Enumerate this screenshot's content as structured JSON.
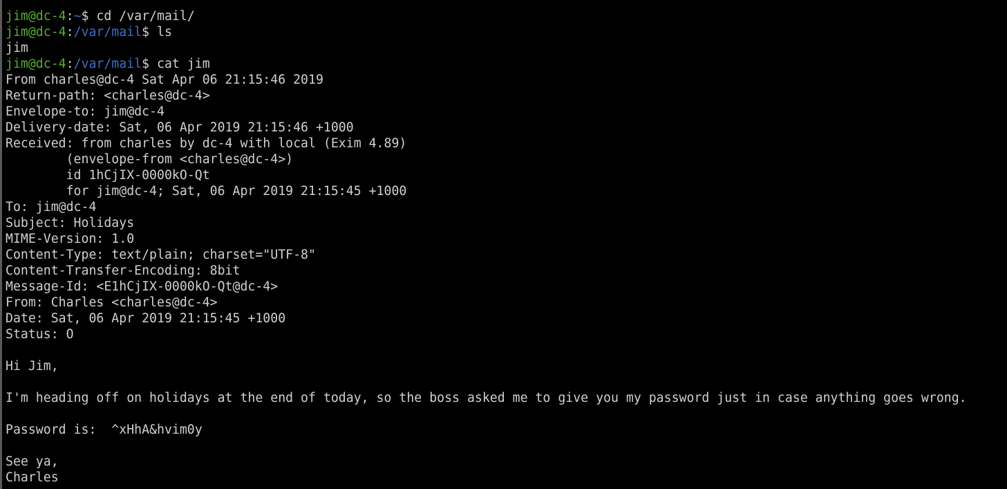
{
  "colors": {
    "background": "#000000",
    "foreground": "#d0d0d0",
    "user_host": "#4fb226",
    "path": "#3b6fc6"
  },
  "session": [
    {
      "type": "prompt",
      "user": "jim@dc-4",
      "sep": ":",
      "path": "~",
      "sym": "$",
      "cmd": " cd /var/mail/"
    },
    {
      "type": "prompt",
      "user": "jim@dc-4",
      "sep": ":",
      "path": "/var/mail",
      "sym": "$",
      "cmd": " ls"
    },
    {
      "type": "output",
      "text": "jim"
    },
    {
      "type": "prompt",
      "user": "jim@dc-4",
      "sep": ":",
      "path": "/var/mail",
      "sym": "$",
      "cmd": " cat jim"
    },
    {
      "type": "output",
      "text": "From charles@dc-4 Sat Apr 06 21:15:46 2019"
    },
    {
      "type": "output",
      "text": "Return-path: <charles@dc-4>"
    },
    {
      "type": "output",
      "text": "Envelope-to: jim@dc-4"
    },
    {
      "type": "output",
      "text": "Delivery-date: Sat, 06 Apr 2019 21:15:46 +1000"
    },
    {
      "type": "output",
      "text": "Received: from charles by dc-4 with local (Exim 4.89)"
    },
    {
      "type": "output",
      "text": "        (envelope-from <charles@dc-4>)"
    },
    {
      "type": "output",
      "text": "        id 1hCjIX-0000kO-Qt"
    },
    {
      "type": "output",
      "text": "        for jim@dc-4; Sat, 06 Apr 2019 21:15:45 +1000"
    },
    {
      "type": "output",
      "text": "To: jim@dc-4"
    },
    {
      "type": "output",
      "text": "Subject: Holidays"
    },
    {
      "type": "output",
      "text": "MIME-Version: 1.0"
    },
    {
      "type": "output",
      "text": "Content-Type: text/plain; charset=\"UTF-8\""
    },
    {
      "type": "output",
      "text": "Content-Transfer-Encoding: 8bit"
    },
    {
      "type": "output",
      "text": "Message-Id: <E1hCjIX-0000kO-Qt@dc-4>"
    },
    {
      "type": "output",
      "text": "From: Charles <charles@dc-4>"
    },
    {
      "type": "output",
      "text": "Date: Sat, 06 Apr 2019 21:15:45 +1000"
    },
    {
      "type": "output",
      "text": "Status: O"
    },
    {
      "type": "output",
      "text": ""
    },
    {
      "type": "output",
      "text": "Hi Jim,"
    },
    {
      "type": "output",
      "text": ""
    },
    {
      "type": "output",
      "text": "I'm heading off on holidays at the end of today, so the boss asked me to give you my password just in case anything goes wrong."
    },
    {
      "type": "output",
      "text": ""
    },
    {
      "type": "output",
      "text": "Password is:  ^xHhA&hvim0y"
    },
    {
      "type": "output",
      "text": ""
    },
    {
      "type": "output",
      "text": "See ya,"
    },
    {
      "type": "output",
      "text": "Charles"
    }
  ]
}
